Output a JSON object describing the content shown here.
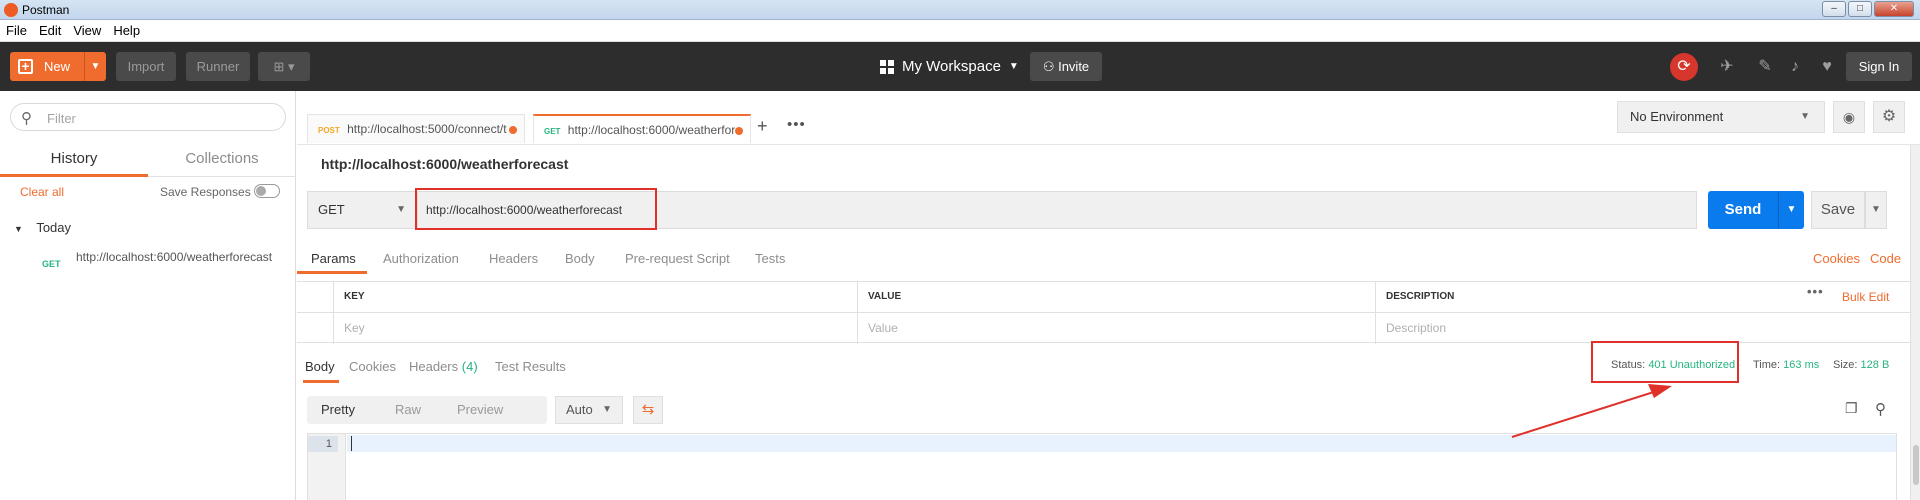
{
  "window": {
    "title": "Postman"
  },
  "menu": [
    "File",
    "Edit",
    "View",
    "Help"
  ],
  "header": {
    "new_label": "New",
    "import_label": "Import",
    "runner_label": "Runner",
    "workspace_label": "My Workspace",
    "invite_label": "Invite",
    "signin_label": "Sign In"
  },
  "sidebar": {
    "filter_placeholder": "Filter",
    "tabs": [
      "History",
      "Collections"
    ],
    "clear_all": "Clear all",
    "save_responses": "Save Responses",
    "group_label": "Today",
    "items": [
      {
        "method": "GET",
        "url": "http://localhost:6000/weatherforecast"
      }
    ]
  },
  "tabs": [
    {
      "method": "POST",
      "url": "http://localhost:5000/connect/t"
    },
    {
      "method": "GET",
      "url": "http://localhost:6000/weatherfor"
    }
  ],
  "environment": {
    "selected": "No Environment"
  },
  "request": {
    "name": "http://localhost:6000/weatherforecast",
    "method": "GET",
    "url": "http://localhost:6000/weatherforecast",
    "send_label": "Send",
    "save_label": "Save",
    "tabs": [
      "Params",
      "Authorization",
      "Headers",
      "Body",
      "Pre-request Script",
      "Tests"
    ],
    "links": {
      "cookies": "Cookies",
      "code": "Code"
    },
    "params": {
      "headers": [
        "KEY",
        "VALUE",
        "DESCRIPTION"
      ],
      "placeholders": [
        "Key",
        "Value",
        "Description"
      ],
      "bulk_edit": "Bulk Edit"
    }
  },
  "response": {
    "tabs": [
      {
        "label": "Body"
      },
      {
        "label": "Cookies"
      },
      {
        "label": "Headers",
        "count": "(4)"
      },
      {
        "label": "Test Results"
      }
    ],
    "status_label": "Status:",
    "status_value": "401 Unauthorized",
    "time_label": "Time:",
    "time_value": "163 ms",
    "size_label": "Size:",
    "size_value": "128 B",
    "format_buttons": [
      "Pretty",
      "Raw",
      "Preview"
    ],
    "format_select": "Auto",
    "line_number": "1"
  },
  "colors": {
    "accent": "#ef6c2e",
    "send": "#097bed",
    "success": "#26b47f",
    "annotation": "#e0302a"
  }
}
